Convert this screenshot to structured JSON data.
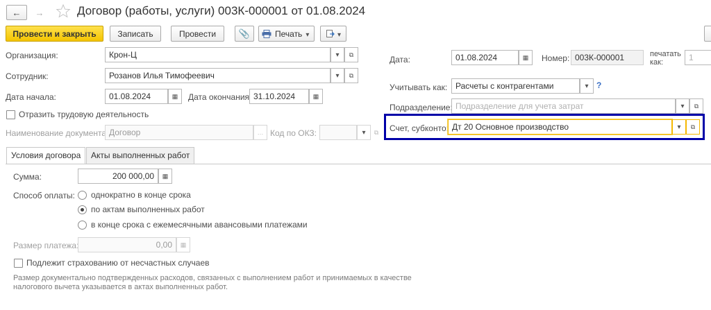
{
  "window": {
    "title": "Договор (работы, услуги) 003К-000001 от 01.08.2024"
  },
  "toolbar": {
    "post_close": "Провести и закрыть",
    "save": "Записать",
    "post": "Провести",
    "print": "Печать"
  },
  "left": {
    "org_label": "Организация:",
    "org_value": "Крон-Ц",
    "employee_label": "Сотрудник:",
    "employee_value": "Розанов Илья Тимофеевич",
    "start_label": "Дата начала:",
    "start_value": "01.08.2024",
    "end_label": "Дата окончания:",
    "end_value": "31.10.2024",
    "labor_checkbox": "Отразить трудовую деятельность",
    "docname_label": "Наименование документа:",
    "docname_value": "Договор",
    "okz_label": "Код по ОКЗ:",
    "okz_value": ""
  },
  "right": {
    "date_label": "Дата:",
    "date_value": "01.08.2024",
    "number_label": "Номер:",
    "number_value": "003К-000001",
    "print_as_label": "печатать как:",
    "print_as_value": "1",
    "account_as_label": "Учитывать как:",
    "account_as_value": "Расчеты с контрагентами",
    "help": "?",
    "division_label": "Подразделение:",
    "division_placeholder": "Подразделение для учета затрат",
    "subconto_label": "Счет, субконто:",
    "subconto_value": "Дт 20 Основное производство"
  },
  "tabs": [
    {
      "label": "Условия договора",
      "active": true
    },
    {
      "label": "Акты выполненных работ",
      "active": false
    }
  ],
  "conditions": {
    "sum_label": "Сумма:",
    "sum_value": "200 000,00",
    "payment_label": "Способ оплаты:",
    "payment_options": [
      {
        "label": "однократно в конце срока",
        "selected": false
      },
      {
        "label": "по актам выполненных работ",
        "selected": true
      },
      {
        "label": "в конце срока с ежемесячными авансовыми платежами",
        "selected": false
      }
    ],
    "payment_size_label": "Размер платежа:",
    "payment_size_value": "0,00",
    "insurance_checkbox": "Подлежит страхованию от несчастных случаев",
    "note": "Размер документально подтвержденных расходов, связанных с выполнением работ и принимаемых в качестве налогового вычета указывается в актах выполненных работ."
  },
  "colors": {
    "primary_button": "#f4c400",
    "highlight_border": "#0000a8",
    "focus_border": "#f5b800",
    "help": "#3a6fc4"
  }
}
